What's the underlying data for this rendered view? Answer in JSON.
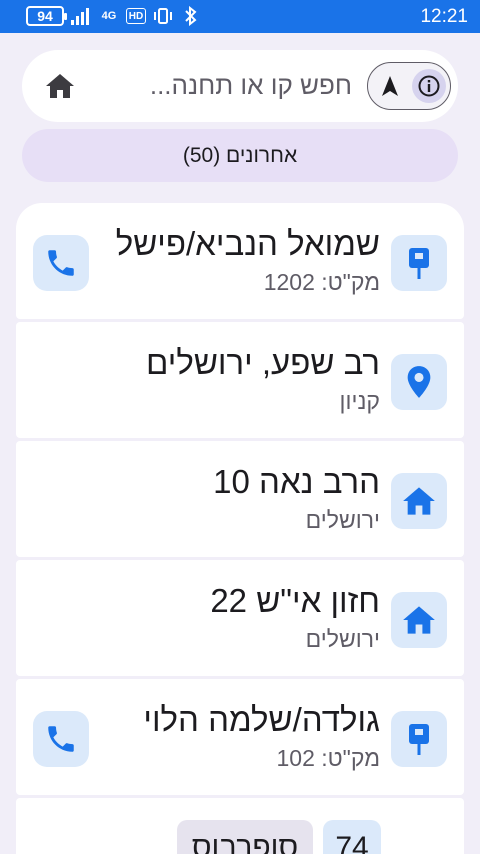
{
  "status_bar": {
    "battery": "94",
    "network_label": "4G",
    "hd_label": "HD",
    "time": "12:21"
  },
  "search": {
    "placeholder": "חפש קו או תחנה..."
  },
  "recents": {
    "label": "אחרונים (50)"
  },
  "colors": {
    "status_bar": "#1a73e8",
    "accent": "#1a73e8",
    "icon_bg": "#dbe9fa",
    "chip_bg": "#e7dff6"
  },
  "items": [
    {
      "icon": "bus-stop-icon",
      "title": "שמואל הנביא/פישל",
      "subtitle": "מק\"ט: 1202",
      "has_call": true
    },
    {
      "icon": "place-pin-icon",
      "title": "רב שפע, ירושלים",
      "subtitle": "קניון",
      "has_call": false
    },
    {
      "icon": "home-icon",
      "title": "הרב נאה 10",
      "subtitle": "ירושלים",
      "has_call": false
    },
    {
      "icon": "home-icon",
      "title": "חזון אי\"ש 22",
      "subtitle": "ירושלים",
      "has_call": false
    },
    {
      "icon": "bus-stop-icon",
      "title": "גולדה/שלמה הלוי",
      "subtitle": "מק\"ט: 102",
      "has_call": true
    }
  ],
  "partial_item": {
    "line_number": "74",
    "line_name": "סופרבוס"
  }
}
